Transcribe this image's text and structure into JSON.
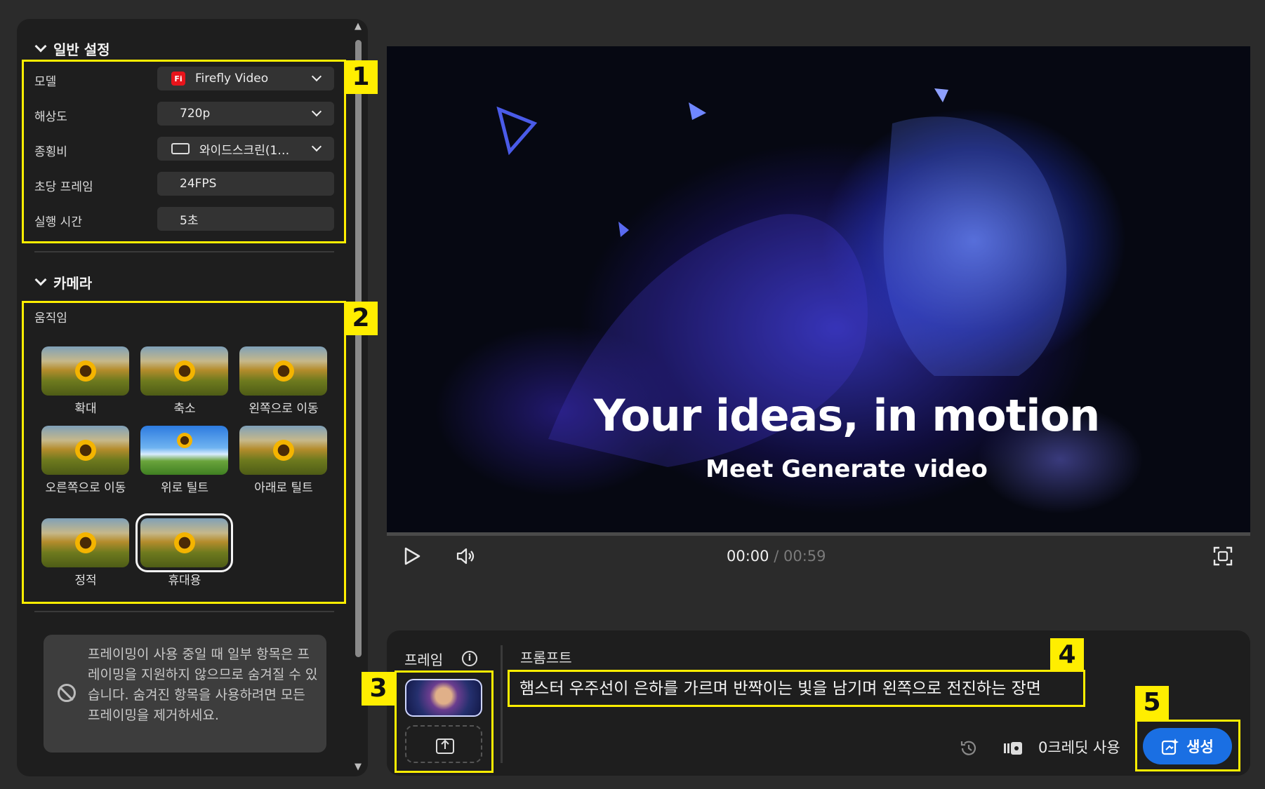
{
  "general": {
    "title": "일반 설정",
    "model_label": "모델",
    "model_value": "Firefly Video",
    "model_badge": "Fi",
    "resolution_label": "해상도",
    "resolution_value": "720p",
    "aspect_label": "종횡비",
    "aspect_value": "와이드스크린(1…",
    "fps_label": "초당 프레임",
    "fps_value": "24FPS",
    "duration_label": "실행 시간",
    "duration_value": "5초"
  },
  "camera": {
    "title": "카메라",
    "motion_label": "움직임",
    "motions": [
      "확대",
      "축소",
      "왼쪽으로 이동",
      "오른쪽으로 이동",
      "위로 틸트",
      "아래로 틸트",
      "정적",
      "휴대용"
    ],
    "selected_motion": "휴대용"
  },
  "notice": {
    "text": "프레이밍이 사용 중일 때 일부 항목은 프레이밍을 지원하지 않으므로 숨겨질 수 있습니다. 숨겨진 항목을 사용하려면 모든 프레이밍을 제거하세요."
  },
  "video": {
    "headline": "Your ideas, in motion",
    "subheadline": "Meet Generate video",
    "time_current": "00:00",
    "time_separator": " / ",
    "time_total": "00:59"
  },
  "prompt": {
    "frame_label": "프레임",
    "prompt_label": "프롬프트",
    "prompt_text": "햄스터 우주선이 은하를 가르며 반짝이는 빛을 남기며 왼쪽으로 전진하는 장면",
    "credits_text": "0크레딧 사용",
    "generate_label": "생성"
  },
  "annotations": [
    "1",
    "2",
    "3",
    "4",
    "5"
  ],
  "colors": {
    "accent": "#1a6fe3",
    "annotation": "#ffee00",
    "panel": "#1e1e1e",
    "background": "#2b2b2b"
  },
  "icons": [
    "chevron-down-icon",
    "firefly-icon",
    "aspect-ratio-icon",
    "ban-icon",
    "play-icon",
    "volume-icon",
    "fullscreen-icon",
    "info-icon",
    "upload-icon",
    "history-icon",
    "credits-icon",
    "generate-icon"
  ]
}
